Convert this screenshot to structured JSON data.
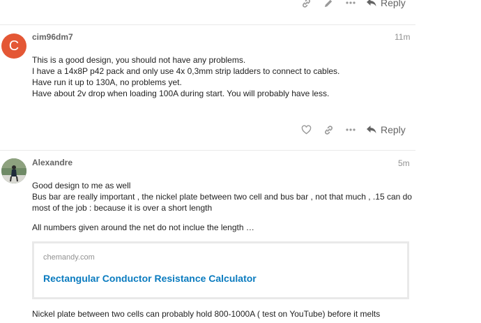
{
  "top_actions": {
    "reply_label": "Reply"
  },
  "posts": [
    {
      "username": "cim96dm7",
      "avatar_letter": "C",
      "avatar_color": "#e45735",
      "time": "11m",
      "lines": [
        "This is a good design, you should not have any problems.",
        "I have a 14x8P p42 pack and only use 4x 0,3mm strip ladders to connect to cables.",
        "Have run it up to 130A, no problems yet.",
        "Have about 2v drop when loading 100A during start. You will probably have less."
      ],
      "reply_label": "Reply"
    },
    {
      "username": "Alexandre",
      "time": "5m",
      "paragraph1": [
        "Good design to me as well",
        "Bus bar are really important , the nickel plate between two cell and bus bar , not that much , .15 can do",
        "most of the job : because it is over a short length"
      ],
      "paragraph2": "All numbers given around the net do not inclue the length …",
      "onebox": {
        "source": "chemandy.com",
        "title": "Rectangular Conductor Resistance Calculator"
      },
      "paragraph3": "Nickel plate between two cells can probably hold 800-1000A ( test on YouTube) before it melts"
    }
  ],
  "colors": {
    "link": "#0a7bbf",
    "icon": "#999999",
    "divider": "#e9e9e9"
  }
}
